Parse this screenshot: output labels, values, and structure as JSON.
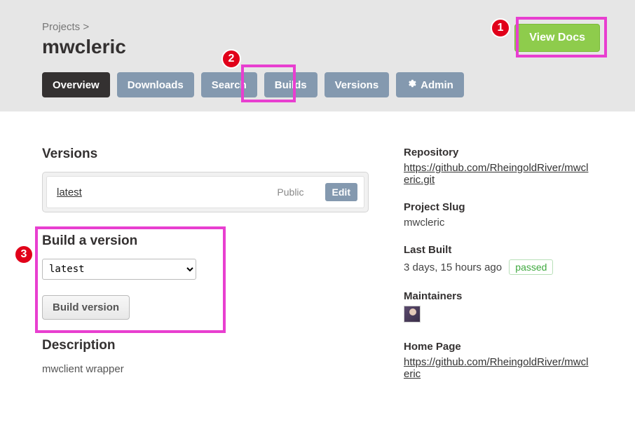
{
  "breadcrumb": {
    "projects": "Projects",
    "sep": ">"
  },
  "project": {
    "name": "mwcleric"
  },
  "actions": {
    "view_docs": "View Docs"
  },
  "tabs": {
    "overview": "Overview",
    "downloads": "Downloads",
    "search": "Search",
    "builds": "Builds",
    "versions": "Versions",
    "admin": "Admin"
  },
  "sections": {
    "versions": "Versions",
    "build": "Build a version",
    "description": "Description"
  },
  "versions_list": [
    {
      "name": "latest",
      "visibility": "Public",
      "edit": "Edit"
    }
  ],
  "build": {
    "selected": "latest",
    "button": "Build version"
  },
  "description": "mwclient wrapper",
  "meta": {
    "repository": {
      "label": "Repository",
      "value": "https://github.com/RheingoldRiver/mwcleric.git"
    },
    "slug": {
      "label": "Project Slug",
      "value": "mwcleric"
    },
    "last_built": {
      "label": "Last Built",
      "value": "3 days, 15 hours ago",
      "status": "passed"
    },
    "maintainers": {
      "label": "Maintainers"
    },
    "home_page": {
      "label": "Home Page",
      "value": "https://github.com/RheingoldRiver/mwcleric"
    }
  },
  "annotations": {
    "1": "1",
    "2": "2",
    "3": "3"
  }
}
